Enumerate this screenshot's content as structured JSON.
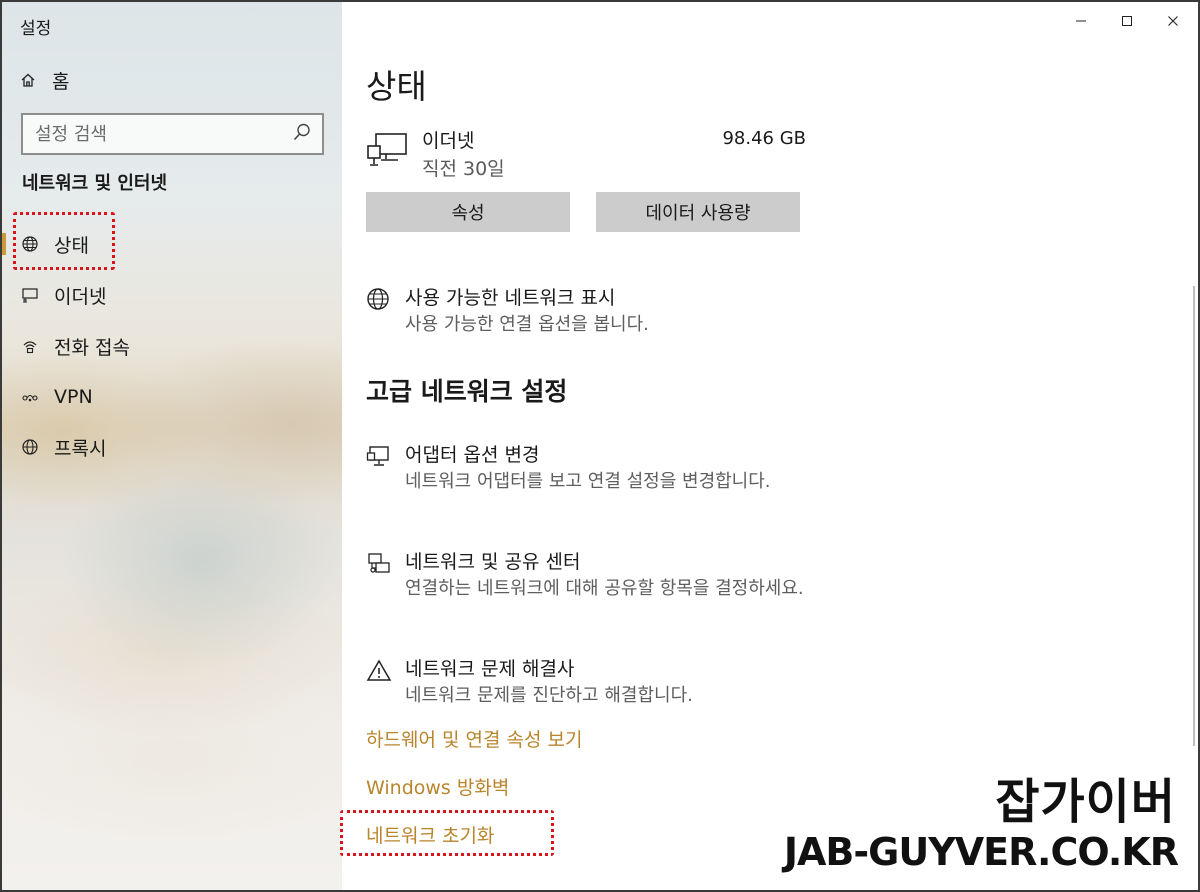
{
  "window": {
    "app_title": "설정",
    "controls": {
      "minimize": "—",
      "maximize": "☐",
      "close": "✕"
    }
  },
  "sidebar": {
    "home_label": "홈",
    "search": {
      "placeholder": "설정 검색"
    },
    "section_title": "네트워크 및 인터넷",
    "items": [
      {
        "label": "상태",
        "icon": "status-globe-icon",
        "active": true
      },
      {
        "label": "이더넷",
        "icon": "ethernet-icon",
        "active": false
      },
      {
        "label": "전화 접속",
        "icon": "dial-up-icon",
        "active": false
      },
      {
        "label": "VPN",
        "icon": "vpn-icon",
        "active": false
      },
      {
        "label": "프록시",
        "icon": "globe-icon",
        "active": false
      }
    ]
  },
  "main": {
    "title": "상태",
    "connection": {
      "name": "이더넷",
      "period": "직전 30일",
      "usage": "98.46 GB"
    },
    "buttons": {
      "properties": "속성",
      "data_usage": "데이터 사용량"
    },
    "show_networks": {
      "title": "사용 가능한 네트워크 표시",
      "desc": "사용 가능한 연결 옵션을 봅니다."
    },
    "advanced_heading": "고급 네트워크 설정",
    "adapter": {
      "title": "어댑터 옵션 변경",
      "desc": "네트워크 어댑터를 보고 연결 설정을 변경합니다."
    },
    "sharing_center": {
      "title": "네트워크 및 공유 센터",
      "desc": "연결하는 네트워크에 대해 공유할 항목을 결정하세요."
    },
    "troubleshooter": {
      "title": "네트워크 문제 해결사",
      "desc": "네트워크 문제를 진단하고 해결합니다."
    },
    "links": {
      "hardware": "하드웨어 및 연결 속성 보기",
      "firewall": "Windows 방화벽",
      "reset": "네트워크 초기화"
    }
  },
  "watermark": {
    "brand": "잡가이버",
    "url": "JAB-GUYVER.CO.KR"
  },
  "colors": {
    "accent": "#c89a3c",
    "link": "#b9852c",
    "button": "#cccccc",
    "highlight": "#d9141a"
  }
}
